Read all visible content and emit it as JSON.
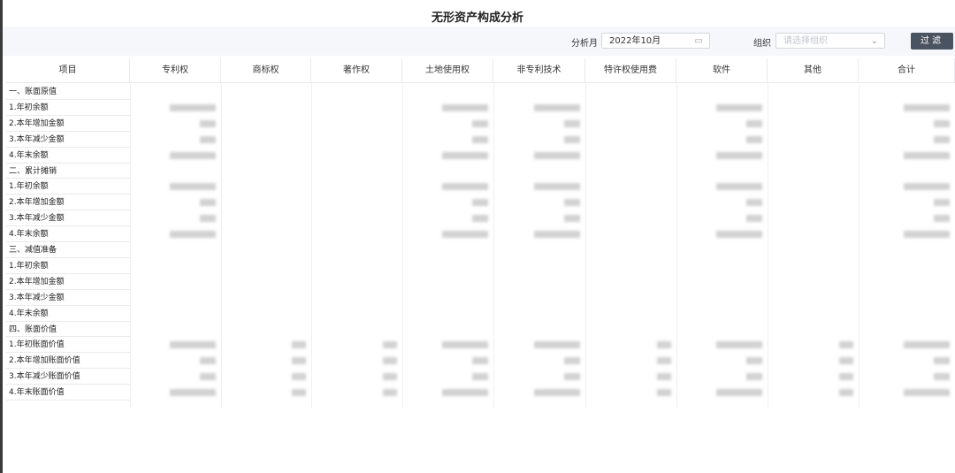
{
  "page": {
    "title": "无形资产构成分析"
  },
  "filters": {
    "month_label": "分析月",
    "month_value": "2022年10月",
    "org_label": "组织",
    "org_placeholder": "请选择组织",
    "filter_button": "过滤"
  },
  "table": {
    "headers": [
      "项目",
      "专利权",
      "商标权",
      "著作权",
      "土地使用权",
      "非专利技术",
      "特许权使用费",
      "软件",
      "其他",
      "合计"
    ],
    "rows": [
      "一、账面原值",
      "1.年初余额",
      "2.本年增加金额",
      "3.本年减少金额",
      "4.年末余额",
      "二、累计摊销",
      "1.年初余额",
      "2.本年增加金额",
      "3.本年减少金额",
      "4.年末余额",
      "三、减值准备",
      "1.年初余额",
      "2.本年增加金额",
      "3.本年减少金额",
      "4.年末余额",
      "四、账面价值",
      "1.年初账面价值",
      "2.本年增加账面价值",
      "3.本年减少账面价值",
      "4.年末账面价值"
    ]
  }
}
